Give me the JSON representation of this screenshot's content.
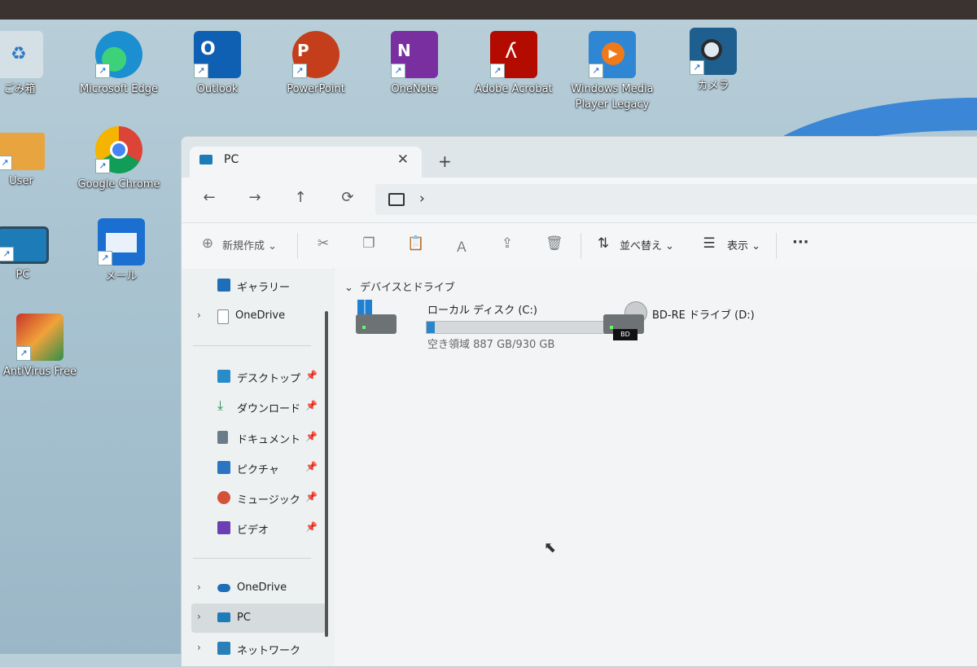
{
  "desktop": {
    "icons": [
      {
        "label": "ごみ箱",
        "icon": "recycle-bin-icon",
        "color": "#7b9fb5"
      },
      {
        "label": "Microsoft Edge",
        "icon": "edge-icon",
        "color": "#1b8fcf"
      },
      {
        "label": "Outlook",
        "icon": "outlook-icon",
        "color": "#0f5fb3"
      },
      {
        "label": "PowerPoint",
        "icon": "powerpoint-icon",
        "color": "#c43e1c"
      },
      {
        "label": "OneNote",
        "icon": "onenote-icon",
        "color": "#7a2fa0"
      },
      {
        "label": "Adobe Acrobat",
        "icon": "acrobat-icon",
        "color": "#b30b00"
      },
      {
        "label": "Windows Media Player Legacy",
        "icon": "media-player-icon",
        "color": "#f07a1a"
      },
      {
        "label": "カメラ",
        "icon": "camera-icon",
        "color": "#1f5f8f"
      },
      {
        "label": "User",
        "icon": "folder-icon",
        "color": "#e7a43f"
      },
      {
        "label": "Google Chrome",
        "icon": "chrome-icon",
        "color": "#db4437"
      },
      {
        "label": "PC",
        "icon": "pc-icon",
        "color": "#1d7bb8"
      },
      {
        "label": "メール",
        "icon": "mail-icon",
        "color": "#1a6fd1"
      },
      {
        "label": "AntiVirus Free",
        "icon": "antivirus-icon",
        "color": "#c8352a"
      }
    ]
  },
  "explorer": {
    "tab_title": "PC",
    "toolbar": {
      "new_label": "新規作成",
      "sort_label": "並べ替え",
      "view_label": "表示",
      "more_label": "···"
    },
    "sidebar": {
      "gallery": "ギャラリー",
      "onedrive_top": "OneDrive",
      "quick": [
        {
          "label": "デスクトップ"
        },
        {
          "label": "ダウンロード"
        },
        {
          "label": "ドキュメント"
        },
        {
          "label": "ピクチャ"
        },
        {
          "label": "ミュージック"
        },
        {
          "label": "ビデオ"
        }
      ],
      "onedrive": "OneDrive",
      "pc": "PC",
      "network": "ネットワーク"
    },
    "section_title": "デバイスとドライブ",
    "drives": [
      {
        "name": "ローカル ディスク (C:)",
        "free_text": "空き領域 887 GB/930 GB",
        "used_fraction": 0.046
      },
      {
        "name": "BD-RE ドライブ (D:)",
        "badge": "BD"
      }
    ]
  }
}
